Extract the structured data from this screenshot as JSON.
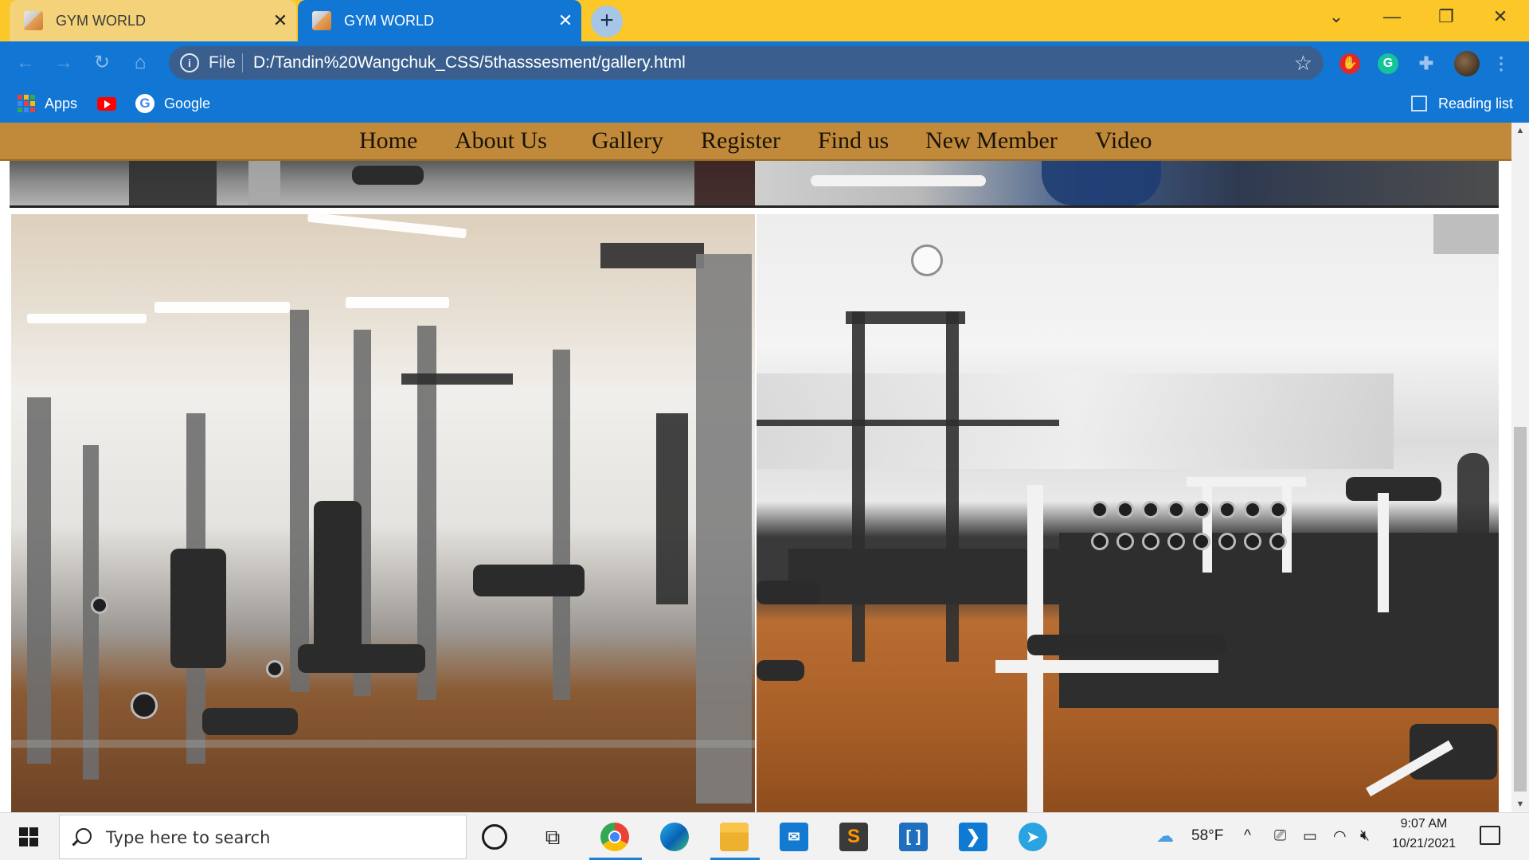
{
  "browser": {
    "tabs": [
      {
        "title": "GYM WORLD",
        "active": false
      },
      {
        "title": "GYM WORLD",
        "active": true
      }
    ],
    "new_tab_label": "+",
    "address": {
      "scheme_label": "File",
      "url": "D:/Tandin%20Wangchuk_CSS/5thasssesment/gallery.html"
    },
    "bookmarks": [
      {
        "label": "Apps",
        "icon": "apps-grid-icon"
      },
      {
        "label": "",
        "icon": "youtube-icon"
      },
      {
        "label": "Google",
        "icon": "google-icon"
      }
    ],
    "reading_list_label": "Reading list",
    "colors": {
      "tabstrip": "#fcc728",
      "toolbar": "#1176d4",
      "omnibox": "#3a5f8e"
    }
  },
  "site": {
    "nav": [
      "Home",
      "About Us",
      "Gallery",
      "Register",
      "Find us",
      "New Member",
      "Video"
    ],
    "nav_color": "#c08a3a"
  },
  "taskbar": {
    "search_placeholder": "Type here to search",
    "weather": "58°F",
    "time": "9:07 AM",
    "date": "10/21/2021",
    "pinned_apps": [
      "cortana-icon",
      "task-view-icon",
      "chrome-icon",
      "edge-icon",
      "file-explorer-icon",
      "mail-icon",
      "sublime-text-icon",
      "brackets-icon",
      "vscode-icon",
      "telegram-icon"
    ]
  }
}
